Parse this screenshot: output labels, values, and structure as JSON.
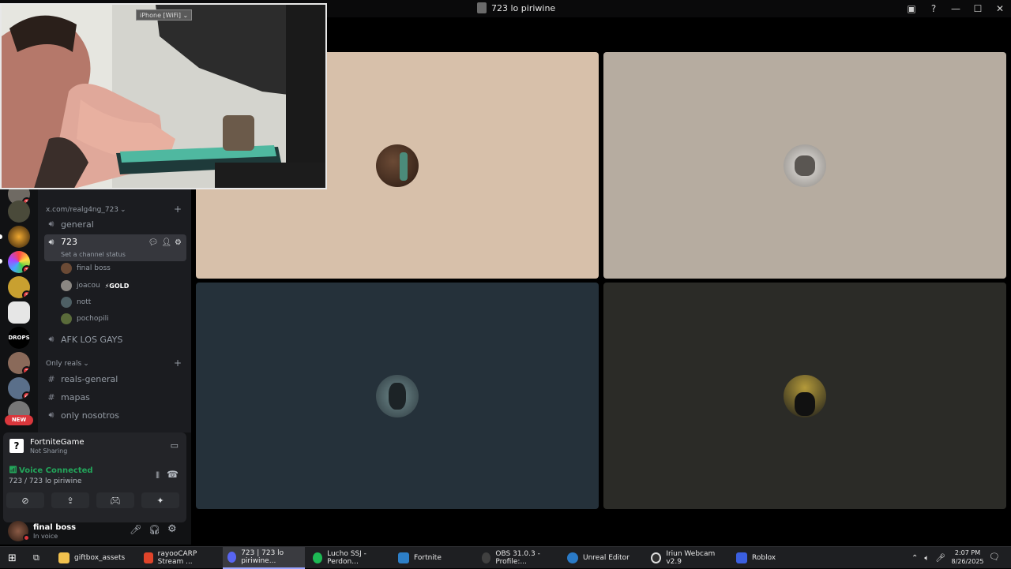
{
  "window": {
    "title": "723 lo piriwine"
  },
  "camera": {
    "device_tag": "iPhone [WiFi]"
  },
  "server_rail": {
    "badges": [
      "1",
      "1",
      "1",
      "DROPS",
      "3",
      "6",
      "NEW"
    ]
  },
  "channels": {
    "category_1": "x.com/realg4ng_723",
    "general": "general",
    "active_channel": "723",
    "active_status": "Set a channel status",
    "voice_users": [
      {
        "name": "final boss",
        "badge": ""
      },
      {
        "name": "joacou",
        "badge": "⚡GOLD"
      },
      {
        "name": "nott",
        "badge": ""
      },
      {
        "name": "pochopili",
        "badge": ""
      }
    ],
    "afk": "AFK LOS GAYS",
    "category_2": "Only reals",
    "reals_general": "reals-general",
    "mapas": "mapas",
    "only_nosotros": "only nosotros"
  },
  "share": {
    "title": "FortniteGame",
    "subtitle": "Not Sharing"
  },
  "voice": {
    "status": "Voice Connected",
    "channel": "723 / 723 lo piriwine"
  },
  "userbar": {
    "name": "final boss",
    "status": "In voice"
  },
  "tiles": [
    {
      "bg": "#d7c0aa"
    },
    {
      "bg": "#b6aca0"
    },
    {
      "bg": "#25313a"
    },
    {
      "bg": "#2b2b27"
    }
  ],
  "taskbar": {
    "items": [
      {
        "label": "giftbox_assets",
        "color": "#f2c14e"
      },
      {
        "label": "rayooCARP Stream ...",
        "color": "#e0442a"
      },
      {
        "label": "723 | 723 lo piriwine...",
        "color": "#5865f2"
      },
      {
        "label": "Lucho SSJ - Perdon...",
        "color": "#1db954"
      },
      {
        "label": "Fortnite",
        "color": "#2d7fc8"
      },
      {
        "label": "OBS 31.0.3 - Profile:...",
        "color": "#404040"
      },
      {
        "label": "Unreal Editor",
        "color": "#2a7ac7"
      },
      {
        "label": "Iriun Webcam v2.9",
        "color": "#303030"
      },
      {
        "label": "Roblox",
        "color": "#3b5fe0"
      }
    ],
    "time": "2:07 PM",
    "date": "8/26/2025"
  },
  "colors": {
    "voice_green": "#23a55a",
    "discord_blurple": "#5865f2",
    "badge_red": "#da373c"
  }
}
